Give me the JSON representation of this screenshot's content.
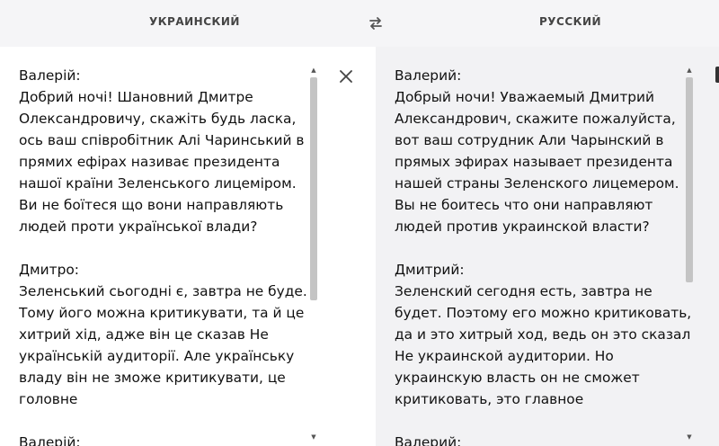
{
  "header": {
    "source_lang": "УКРАИНСКИЙ",
    "target_lang": "РУССКИЙ",
    "swap_icon": "swap-arrows-icon"
  },
  "source": {
    "text": "Валерій:\nДобрий ночі! Шановний Дмитре Олександровичу, скажіть будь ласка, ось ваш співробітник Алі Чаринський в прямих ефірах називає президента нашої країни Зеленського лицеміром. Ви не боїтеся що вони направляють людей проти української влади?\n\nДмитро:\nЗеленський сьогодні є, завтра не буде. Тому його можна критикувати, та й це хитрий хід, адже він це сказав Не українській аудиторії. Але українську владу він не зможе критикувати, це головне\n\nВалерій:",
    "clear_icon": "close-icon"
  },
  "target": {
    "text": "Валерий:\nДобрый ночи! Уважаемый Дмитрий Александрович, скажите пожалуйста, вот ваш сотрудник Али Чарынский в прямых эфирах называет президента нашей страны Зеленского лицемером. Вы не боитесь что они направляют людей против украинской власти?\n\nДмитрий:\nЗеленский сегодня есть, завтра не будет. Поэтому его можно критиковать, да и это хитрый ход, ведь он это сказал Не украинской аудитории. Но украинскую власть он не сможет критиковать, это главное\n\nВалерий:",
    "copy_icon": "copy-icon"
  }
}
